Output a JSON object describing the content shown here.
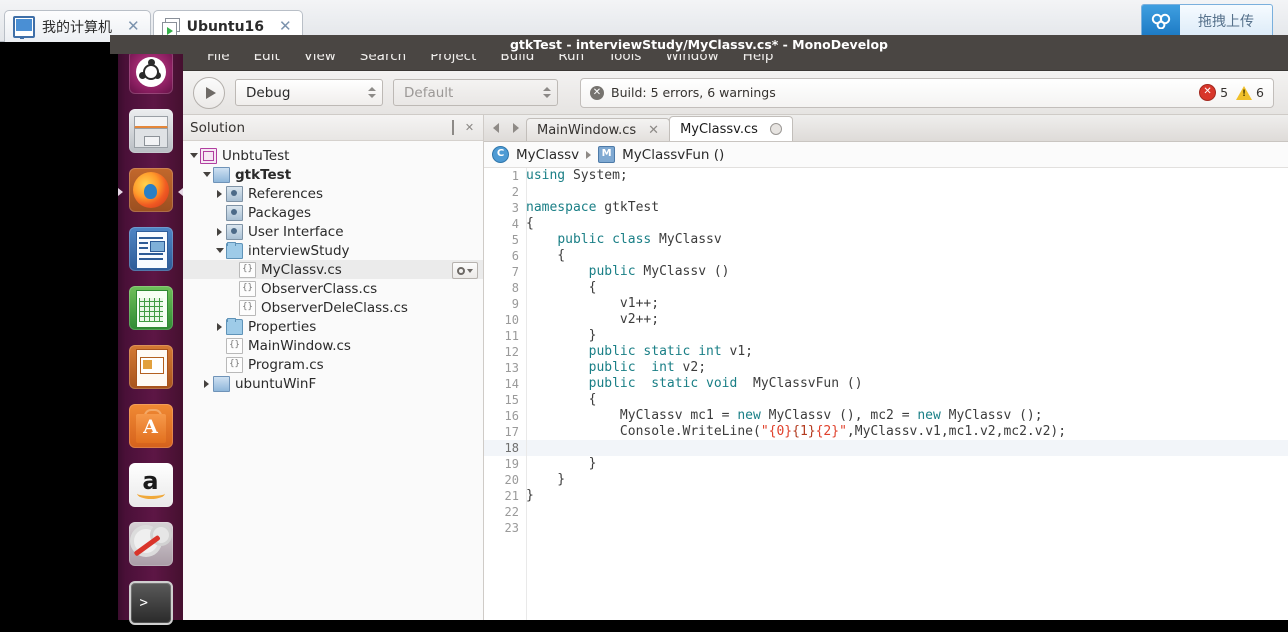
{
  "browser": {
    "tabs": [
      {
        "label": "我的计算机",
        "icon": "monitor-icon",
        "active": false,
        "close": "✕"
      },
      {
        "label": "Ubuntu16",
        "icon": "vm-icon",
        "active": true,
        "close": "✕"
      }
    ],
    "upload_button": {
      "label": "拖拽上传",
      "icon": "upload-cloud-icon"
    }
  },
  "launcher": {
    "items": [
      {
        "name": "ubuntu-dash-icon"
      },
      {
        "name": "files-icon"
      },
      {
        "name": "firefox-icon"
      },
      {
        "name": "libreoffice-writer-icon"
      },
      {
        "name": "libreoffice-calc-icon"
      },
      {
        "name": "libreoffice-impress-icon"
      },
      {
        "name": "ubuntu-software-icon"
      },
      {
        "name": "amazon-icon",
        "glyph": "a"
      },
      {
        "name": "system-settings-icon"
      },
      {
        "name": "terminal-icon",
        "glyph": ">"
      }
    ]
  },
  "window": {
    "title": "gtkTest - interviewStudy/MyClassv.cs* - MonoDevelop",
    "menu": [
      "File",
      "Edit",
      "View",
      "Search",
      "Project",
      "Build",
      "Run",
      "Tools",
      "Window",
      "Help"
    ]
  },
  "toolbar": {
    "run_icon": "play-icon",
    "configuration": "Debug",
    "platform": "Default",
    "status": {
      "icon": "error-circle-icon",
      "text": "Build: 5 errors, 6 warnings",
      "error_count": "5",
      "warning_count": "6",
      "error_color": "#d8362a",
      "warning_color": "#f0c02a"
    }
  },
  "solution_pad": {
    "title": "Solution",
    "buttons": [
      "minimize-pad-icon",
      "close-pad-icon"
    ],
    "close_glyph": "✕",
    "tree": [
      {
        "label": "UnbtuTest",
        "indent": 0,
        "twisty": "down",
        "icon": "solution-icon",
        "bold": false,
        "selected": false
      },
      {
        "label": "gtkTest",
        "indent": 1,
        "twisty": "down",
        "icon": "project-icon",
        "bold": true,
        "selected": false
      },
      {
        "label": "References",
        "indent": 2,
        "twisty": "right",
        "icon": "references-icon",
        "bold": false,
        "selected": false
      },
      {
        "label": "Packages",
        "indent": 2,
        "twisty": "none",
        "icon": "references-icon",
        "bold": false,
        "selected": false
      },
      {
        "label": "User Interface",
        "indent": 2,
        "twisty": "right",
        "icon": "references-icon",
        "bold": false,
        "selected": false
      },
      {
        "label": "interviewStudy",
        "indent": 2,
        "twisty": "down",
        "icon": "folder-icon",
        "bold": false,
        "selected": false
      },
      {
        "label": "MyClassv.cs",
        "indent": 3,
        "twisty": "none",
        "icon": "csharp-file-icon",
        "bold": false,
        "selected": true,
        "gear": true
      },
      {
        "label": "ObserverClass.cs",
        "indent": 3,
        "twisty": "none",
        "icon": "csharp-file-icon",
        "bold": false,
        "selected": false
      },
      {
        "label": "ObserverDeleClass.cs",
        "indent": 3,
        "twisty": "none",
        "icon": "csharp-file-icon",
        "bold": false,
        "selected": false
      },
      {
        "label": "Properties",
        "indent": 2,
        "twisty": "right",
        "icon": "folder-icon",
        "bold": false,
        "selected": false
      },
      {
        "label": "MainWindow.cs",
        "indent": 2,
        "twisty": "none",
        "icon": "csharp-file-icon",
        "bold": false,
        "selected": false
      },
      {
        "label": "Program.cs",
        "indent": 2,
        "twisty": "none",
        "icon": "csharp-file-icon",
        "bold": false,
        "selected": false
      },
      {
        "label": "ubuntuWinF",
        "indent": 1,
        "twisty": "right",
        "icon": "project-icon",
        "bold": false,
        "selected": false
      }
    ],
    "file_icon_glyph": "{}"
  },
  "editor": {
    "nav_back_icon": "chevron-left-icon",
    "nav_forward_icon": "chevron-right-icon",
    "tabs": [
      {
        "label": "MainWindow.cs",
        "active": false,
        "close": "✕"
      },
      {
        "label": "MyClassv.cs",
        "active": true,
        "close": "●"
      }
    ],
    "breadcrumb": {
      "class_icon_glyph": "C",
      "class": "MyClassv",
      "member_icon_glyph": "M",
      "member": "MyClassvFun ()"
    },
    "current_line": 18,
    "lines": [
      {
        "n": 1,
        "tokens": [
          {
            "t": "using",
            "c": "k"
          },
          {
            "t": " System;",
            "c": ""
          }
        ]
      },
      {
        "n": 2,
        "tokens": []
      },
      {
        "n": 3,
        "tokens": [
          {
            "t": "namespace",
            "c": "k"
          },
          {
            "t": " gtkTest",
            "c": ""
          }
        ]
      },
      {
        "n": 4,
        "tokens": [
          {
            "t": "{",
            "c": ""
          }
        ]
      },
      {
        "n": 5,
        "tokens": [
          {
            "t": "    ",
            "c": ""
          },
          {
            "t": "public class",
            "c": "k"
          },
          {
            "t": " MyClassv",
            "c": ""
          }
        ]
      },
      {
        "n": 6,
        "tokens": [
          {
            "t": "    {",
            "c": ""
          }
        ]
      },
      {
        "n": 7,
        "tokens": [
          {
            "t": "        ",
            "c": ""
          },
          {
            "t": "public",
            "c": "k"
          },
          {
            "t": " MyClassv ()",
            "c": ""
          }
        ]
      },
      {
        "n": 8,
        "tokens": [
          {
            "t": "        {",
            "c": ""
          }
        ]
      },
      {
        "n": 9,
        "tokens": [
          {
            "t": "            v1++;",
            "c": ""
          }
        ]
      },
      {
        "n": 10,
        "tokens": [
          {
            "t": "            v2++;",
            "c": ""
          }
        ]
      },
      {
        "n": 11,
        "tokens": [
          {
            "t": "        }",
            "c": ""
          }
        ]
      },
      {
        "n": 12,
        "tokens": [
          {
            "t": "        ",
            "c": ""
          },
          {
            "t": "public static int",
            "c": "k"
          },
          {
            "t": " v1;",
            "c": ""
          }
        ]
      },
      {
        "n": 13,
        "tokens": [
          {
            "t": "        ",
            "c": ""
          },
          {
            "t": "public  int",
            "c": "k"
          },
          {
            "t": " v2;",
            "c": ""
          }
        ]
      },
      {
        "n": 14,
        "tokens": [
          {
            "t": "        ",
            "c": ""
          },
          {
            "t": "public  static void",
            "c": "k"
          },
          {
            "t": "  MyClassvFun ()",
            "c": ""
          }
        ]
      },
      {
        "n": 15,
        "tokens": [
          {
            "t": "        {",
            "c": ""
          }
        ]
      },
      {
        "n": 16,
        "tokens": [
          {
            "t": "            MyClassv mc1 = ",
            "c": ""
          },
          {
            "t": "new",
            "c": "k"
          },
          {
            "t": " MyClassv (), mc2 = ",
            "c": ""
          },
          {
            "t": "new",
            "c": "k"
          },
          {
            "t": " MyClassv ();",
            "c": ""
          }
        ]
      },
      {
        "n": 17,
        "tokens": [
          {
            "t": "            Console.WriteLine(",
            "c": ""
          },
          {
            "t": "\"",
            "c": "s"
          },
          {
            "t": "{0}",
            "c": "s"
          },
          {
            "t": "{1}",
            "c": "s2"
          },
          {
            "t": "{2}",
            "c": "s"
          },
          {
            "t": "\"",
            "c": "s"
          },
          {
            "t": ",MyClassv.v1,mc1.v2,mc2.v2);",
            "c": ""
          }
        ]
      },
      {
        "n": 18,
        "tokens": []
      },
      {
        "n": 19,
        "tokens": [
          {
            "t": "        }",
            "c": ""
          }
        ]
      },
      {
        "n": 20,
        "tokens": [
          {
            "t": "    }",
            "c": ""
          }
        ]
      },
      {
        "n": 21,
        "tokens": [
          {
            "t": "}",
            "c": ""
          }
        ]
      },
      {
        "n": 22,
        "tokens": []
      },
      {
        "n": 23,
        "tokens": []
      }
    ]
  }
}
